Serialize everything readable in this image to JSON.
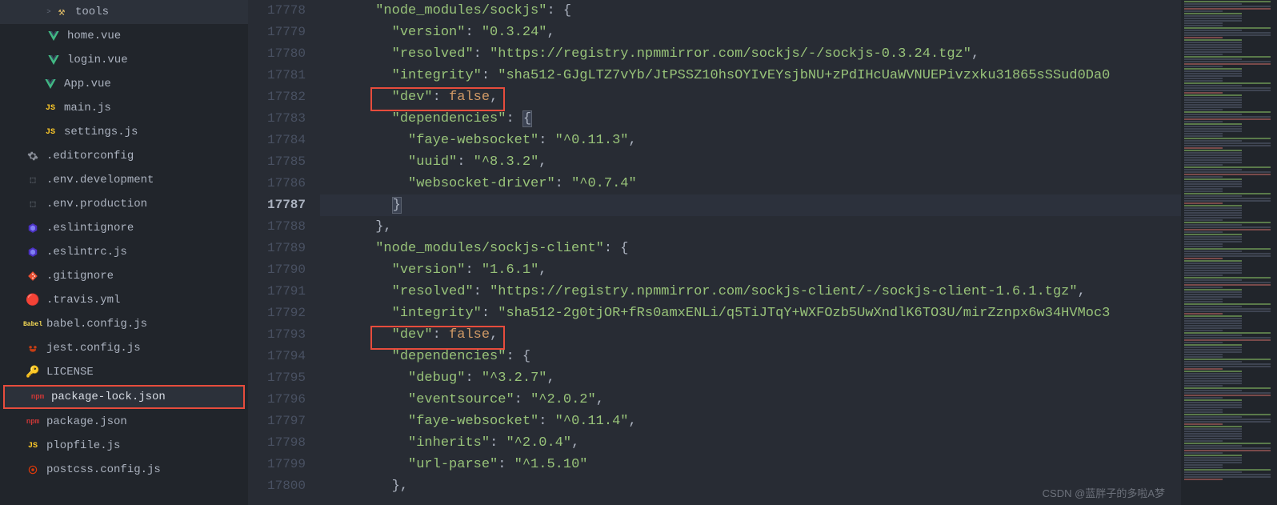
{
  "sidebar": {
    "items": [
      {
        "indent": 2,
        "arrow": ">",
        "icon": "tools",
        "name": "tools"
      },
      {
        "indent": 3,
        "icon": "vue",
        "name": "home.vue"
      },
      {
        "indent": 3,
        "icon": "vue",
        "name": "login.vue"
      },
      {
        "indent": 2,
        "icon": "vue",
        "name": "App.vue"
      },
      {
        "indent": 2,
        "icon": "js",
        "name": "main.js"
      },
      {
        "indent": 2,
        "icon": "js",
        "name": "settings.js"
      },
      {
        "indent": 1,
        "icon": "gear",
        "name": ".editorconfig"
      },
      {
        "indent": 1,
        "icon": "env",
        "name": ".env.development"
      },
      {
        "indent": 1,
        "icon": "env",
        "name": ".env.production"
      },
      {
        "indent": 1,
        "icon": "eslint",
        "name": ".eslintignore"
      },
      {
        "indent": 1,
        "icon": "eslint",
        "name": ".eslintrc.js"
      },
      {
        "indent": 1,
        "icon": "git",
        "name": ".gitignore"
      },
      {
        "indent": 1,
        "icon": "travis",
        "name": ".travis.yml"
      },
      {
        "indent": 1,
        "icon": "babel",
        "name": "babel.config.js"
      },
      {
        "indent": 1,
        "icon": "jest",
        "name": "jest.config.js"
      },
      {
        "indent": 1,
        "icon": "lic",
        "name": "LICENSE"
      },
      {
        "indent": 1,
        "icon": "npm",
        "name": "package-lock.json",
        "active": true,
        "highlighted": true
      },
      {
        "indent": 1,
        "icon": "npm",
        "name": "package.json"
      },
      {
        "indent": 1,
        "icon": "js",
        "name": "plopfile.js"
      },
      {
        "indent": 1,
        "icon": "postcss",
        "name": "postcss.config.js"
      }
    ]
  },
  "editor": {
    "lines": [
      {
        "num": 17778,
        "indent": 3,
        "tokens": [
          [
            "key",
            "\"node_modules/sockjs\""
          ],
          [
            "punc",
            ": {"
          ]
        ]
      },
      {
        "num": 17779,
        "indent": 4,
        "tokens": [
          [
            "key",
            "\"version\""
          ],
          [
            "punc",
            ": "
          ],
          [
            "str",
            "\"0.3.24\""
          ],
          [
            "punc",
            ","
          ]
        ]
      },
      {
        "num": 17780,
        "indent": 4,
        "tokens": [
          [
            "key",
            "\"resolved\""
          ],
          [
            "punc",
            ": "
          ],
          [
            "str",
            "\"https://registry.npmmirror.com/sockjs/-/sockjs-0.3.24.tgz\""
          ],
          [
            "punc",
            ","
          ]
        ]
      },
      {
        "num": 17781,
        "indent": 4,
        "tokens": [
          [
            "key",
            "\"integrity\""
          ],
          [
            "punc",
            ": "
          ],
          [
            "str",
            "\"sha512-GJgLTZ7vYb/JtPSSZ10hsOYIvEYsjbNU+zPdIHcUaWVNUEPivzxku31865sSSud0Da0"
          ]
        ]
      },
      {
        "num": 17782,
        "indent": 4,
        "tokens": [
          [
            "key",
            "\"dev\""
          ],
          [
            "punc",
            ": "
          ],
          [
            "kw",
            "false"
          ],
          [
            "punc",
            ","
          ]
        ]
      },
      {
        "num": 17783,
        "indent": 4,
        "tokens": [
          [
            "key",
            "\"dependencies\""
          ],
          [
            "punc",
            ": "
          ],
          [
            "match",
            "{"
          ]
        ]
      },
      {
        "num": 17784,
        "indent": 5,
        "tokens": [
          [
            "key",
            "\"faye-websocket\""
          ],
          [
            "punc",
            ": "
          ],
          [
            "str",
            "\"^0.11.3\""
          ],
          [
            "punc",
            ","
          ]
        ]
      },
      {
        "num": 17785,
        "indent": 5,
        "tokens": [
          [
            "key",
            "\"uuid\""
          ],
          [
            "punc",
            ": "
          ],
          [
            "str",
            "\"^8.3.2\""
          ],
          [
            "punc",
            ","
          ]
        ]
      },
      {
        "num": 17786,
        "indent": 5,
        "tokens": [
          [
            "key",
            "\"websocket-driver\""
          ],
          [
            "punc",
            ": "
          ],
          [
            "str",
            "\"^0.7.4\""
          ]
        ]
      },
      {
        "num": 17787,
        "indent": 4,
        "current": true,
        "tokens": [
          [
            "match",
            "}"
          ]
        ]
      },
      {
        "num": 17788,
        "indent": 3,
        "tokens": [
          [
            "punc",
            "},"
          ]
        ]
      },
      {
        "num": 17789,
        "indent": 3,
        "tokens": [
          [
            "key",
            "\"node_modules/sockjs-client\""
          ],
          [
            "punc",
            ": {"
          ]
        ]
      },
      {
        "num": 17790,
        "indent": 4,
        "tokens": [
          [
            "key",
            "\"version\""
          ],
          [
            "punc",
            ": "
          ],
          [
            "str",
            "\"1.6.1\""
          ],
          [
            "punc",
            ","
          ]
        ]
      },
      {
        "num": 17791,
        "indent": 4,
        "tokens": [
          [
            "key",
            "\"resolved\""
          ],
          [
            "punc",
            ": "
          ],
          [
            "str",
            "\"https://registry.npmmirror.com/sockjs-client/-/sockjs-client-1.6.1.tgz\""
          ],
          [
            "punc",
            ","
          ]
        ]
      },
      {
        "num": 17792,
        "indent": 4,
        "tokens": [
          [
            "key",
            "\"integrity\""
          ],
          [
            "punc",
            ": "
          ],
          [
            "str",
            "\"sha512-2g0tjOR+fRs0amxENLi/q5TiJTqY+WXFOzb5UwXndlK6TO3U/mirZznpx6w34HVMoc3"
          ]
        ]
      },
      {
        "num": 17793,
        "indent": 4,
        "tokens": [
          [
            "key",
            "\"dev\""
          ],
          [
            "punc",
            ": "
          ],
          [
            "kw",
            "false"
          ],
          [
            "punc",
            ","
          ]
        ]
      },
      {
        "num": 17794,
        "indent": 4,
        "tokens": [
          [
            "key",
            "\"dependencies\""
          ],
          [
            "punc",
            ": {"
          ]
        ]
      },
      {
        "num": 17795,
        "indent": 5,
        "tokens": [
          [
            "key",
            "\"debug\""
          ],
          [
            "punc",
            ": "
          ],
          [
            "str",
            "\"^3.2.7\""
          ],
          [
            "punc",
            ","
          ]
        ]
      },
      {
        "num": 17796,
        "indent": 5,
        "tokens": [
          [
            "key",
            "\"eventsource\""
          ],
          [
            "punc",
            ": "
          ],
          [
            "str",
            "\"^2.0.2\""
          ],
          [
            "punc",
            ","
          ]
        ]
      },
      {
        "num": 17797,
        "indent": 5,
        "tokens": [
          [
            "key",
            "\"faye-websocket\""
          ],
          [
            "punc",
            ": "
          ],
          [
            "str",
            "\"^0.11.4\""
          ],
          [
            "punc",
            ","
          ]
        ]
      },
      {
        "num": 17798,
        "indent": 5,
        "tokens": [
          [
            "key",
            "\"inherits\""
          ],
          [
            "punc",
            ": "
          ],
          [
            "str",
            "\"^2.0.4\""
          ],
          [
            "punc",
            ","
          ]
        ]
      },
      {
        "num": 17799,
        "indent": 5,
        "tokens": [
          [
            "key",
            "\"url-parse\""
          ],
          [
            "punc",
            ": "
          ],
          [
            "str",
            "\"^1.5.10\""
          ]
        ]
      },
      {
        "num": 17800,
        "indent": 4,
        "tokens": [
          [
            "punc",
            "},"
          ]
        ]
      }
    ]
  },
  "watermark": "CSDN @蓝胖子的多啦A梦"
}
